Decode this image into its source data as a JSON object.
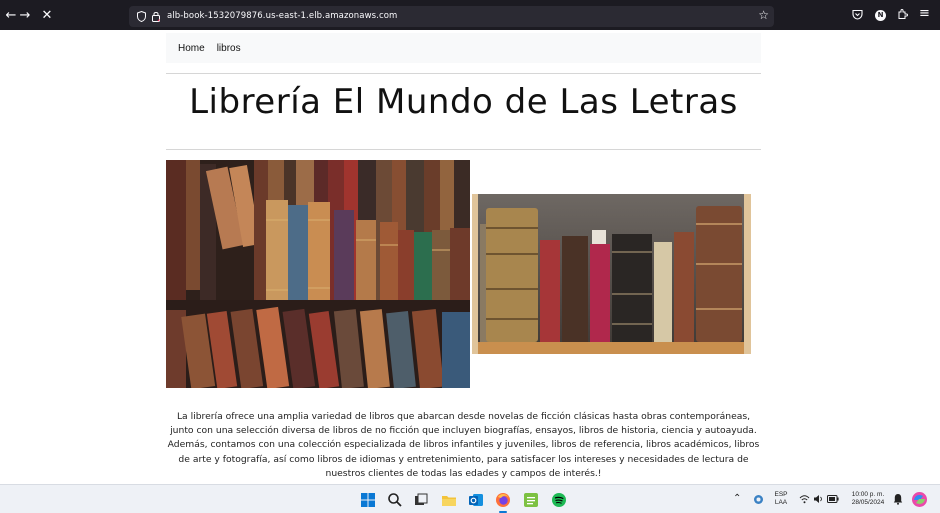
{
  "browser": {
    "url": "alb-book-1532079876.us-east-1.elb.amazonaws.com"
  },
  "nav": {
    "items": [
      "Home",
      "libros"
    ]
  },
  "page": {
    "title": "Librería El Mundo de Las Letras",
    "description": "La librería ofrece una amplia variedad de libros que abarcan desde novelas de ficción clásicas hasta obras contemporáneas, junto con una selección diversa de libros de no ficción que incluyen biografías, ensayos, libros de historia, ciencia y autoayuda. Además, contamos con una colección especializada de libros infantiles y juveniles, libros de referencia, libros académicos, libros de arte y fotografía, así como libros de idiomas y entretenimiento, para satisfacer los intereses y necesidades de lectura de nuestros clientes de todas las edades y campos de interés.!"
  },
  "taskbar": {
    "language": "ESP",
    "layout": "LAA",
    "time": "10:00 p. m.",
    "date": "28/05/2024"
  }
}
